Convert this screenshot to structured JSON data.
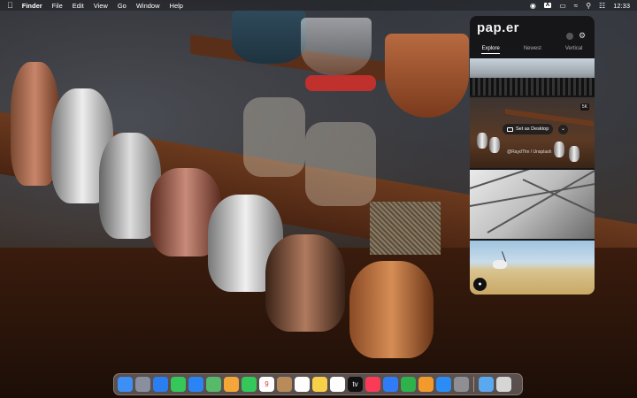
{
  "menubar": {
    "app_name": "Finder",
    "menus": [
      "File",
      "Edit",
      "View",
      "Go",
      "Window",
      "Help"
    ],
    "input_badge": "A",
    "clock": "12:33"
  },
  "wallpaper_app": {
    "logo": "pap.er",
    "tabs": [
      {
        "label": "Explore",
        "active": true
      },
      {
        "label": "Newest",
        "active": false
      },
      {
        "label": "Vertical",
        "active": false
      }
    ],
    "badge": "5K",
    "set_desktop_label": "Set as Desktop",
    "credit": "@RaydThn / Unsplash"
  },
  "dock": {
    "apps": [
      {
        "name": "finder-icon",
        "color": "#3d8ff5"
      },
      {
        "name": "launchpad-icon",
        "color": "#8a8fa0"
      },
      {
        "name": "safari-icon",
        "color": "#2b7ef0"
      },
      {
        "name": "messages-icon",
        "color": "#36c759"
      },
      {
        "name": "mail-icon",
        "color": "#2b84f4"
      },
      {
        "name": "maps-icon",
        "color": "#57b96a"
      },
      {
        "name": "photos-icon",
        "color": "#f4a63a"
      },
      {
        "name": "facetime-icon",
        "color": "#34c759"
      },
      {
        "name": "calendar-icon",
        "color": "#ffffff",
        "text": "9"
      },
      {
        "name": "contacts-icon",
        "color": "#b98a5a"
      },
      {
        "name": "reminders-icon",
        "color": "#ffffff"
      },
      {
        "name": "notes-icon",
        "color": "#f7d04a"
      },
      {
        "name": "freeform-icon",
        "color": "#ffffff"
      },
      {
        "name": "tv-icon",
        "color": "#111111",
        "text": "tv"
      },
      {
        "name": "music-icon",
        "color": "#fa3b57"
      },
      {
        "name": "keynote-icon",
        "color": "#2f7cf6"
      },
      {
        "name": "numbers-icon",
        "color": "#2fb14b"
      },
      {
        "name": "pages-icon",
        "color": "#f39a2c"
      },
      {
        "name": "app-store-icon",
        "color": "#2b8cf5"
      },
      {
        "name": "system-settings-icon",
        "color": "#8e8e93"
      }
    ],
    "trailing": [
      {
        "name": "downloads-folder-icon",
        "color": "#5aa9f0"
      },
      {
        "name": "trash-icon",
        "color": "#d6d6d6"
      }
    ]
  }
}
